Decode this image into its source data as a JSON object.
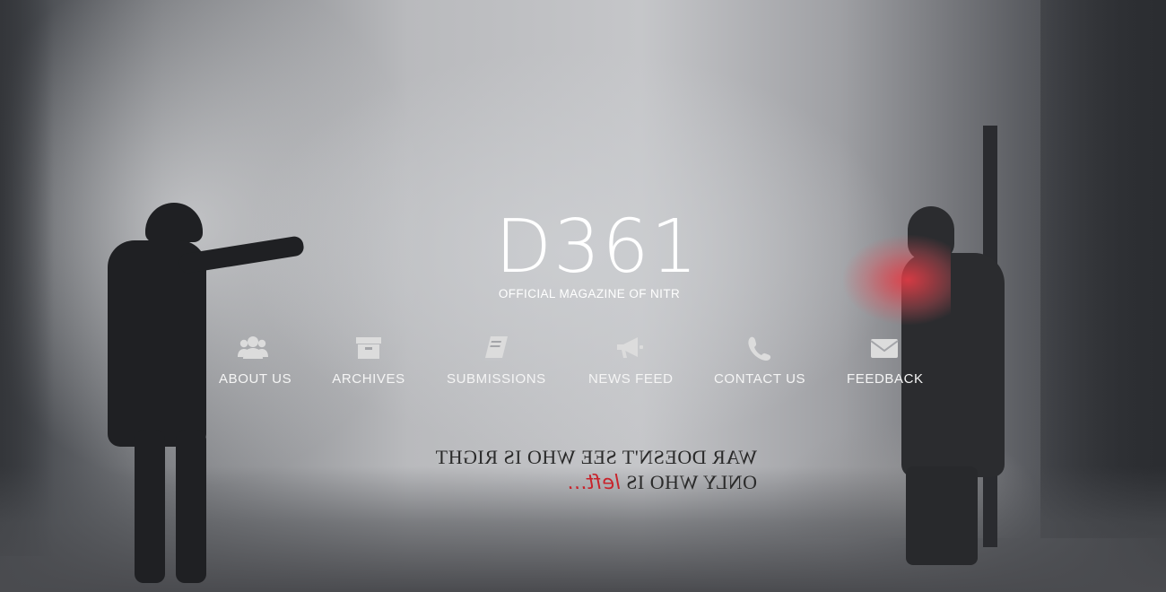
{
  "logo": {
    "mark": "D361",
    "subtitle": "OFFICIAL MAGAZINE OF NITR"
  },
  "nav": {
    "items": [
      {
        "label": "ABOUT US",
        "icon": "users-icon"
      },
      {
        "label": "ARCHIVES",
        "icon": "archive-box-icon"
      },
      {
        "label": "SUBMISSIONS",
        "icon": "book-icon"
      },
      {
        "label": "NEWS FEED",
        "icon": "megaphone-icon"
      },
      {
        "label": "CONTACT US",
        "icon": "phone-icon"
      },
      {
        "label": "FEEDBACK",
        "icon": "envelope-icon"
      }
    ]
  },
  "quote": {
    "line1": "WAR DOESN'T SEE WHO IS RIGHT",
    "line2_prefix": "ONLY WHO IS ",
    "line2_accent": "left...",
    "accent_color": "#c8232b"
  },
  "colors": {
    "nav_icon": "#dcdcdc",
    "text": "#ffffff"
  }
}
